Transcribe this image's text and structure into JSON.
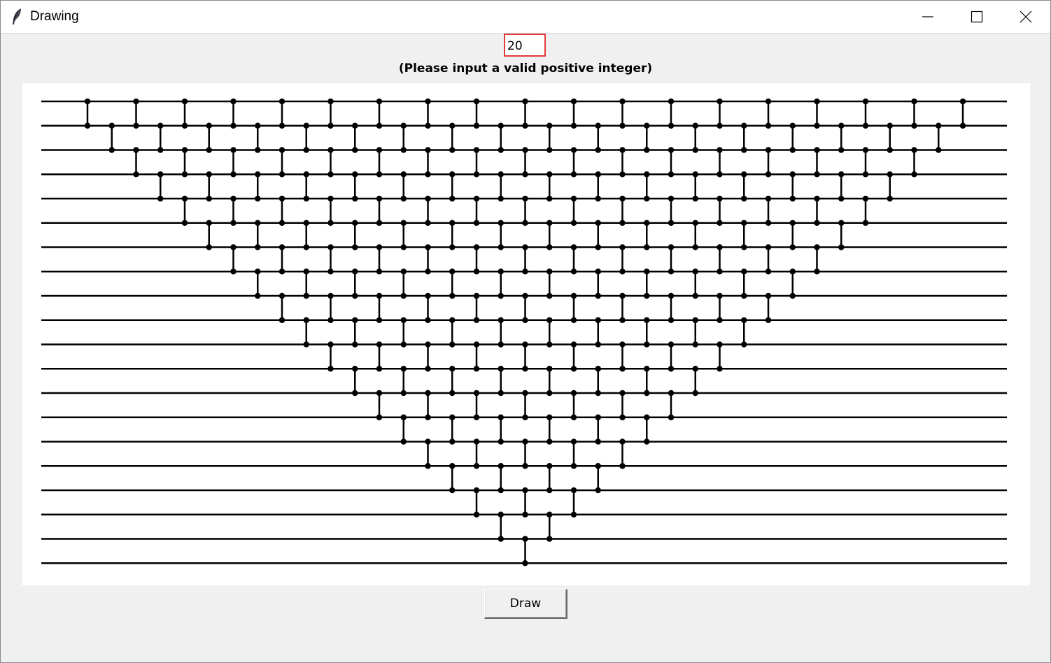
{
  "window": {
    "title": "Drawing"
  },
  "form": {
    "input_value": "20",
    "hint": "(Please input a valid positive integer)",
    "button_label": "Draw"
  },
  "network": {
    "wires": 20
  },
  "icons": {
    "app": "feather-icon",
    "minimize": "minimize-icon",
    "maximize": "maximize-icon",
    "close": "close-icon"
  }
}
